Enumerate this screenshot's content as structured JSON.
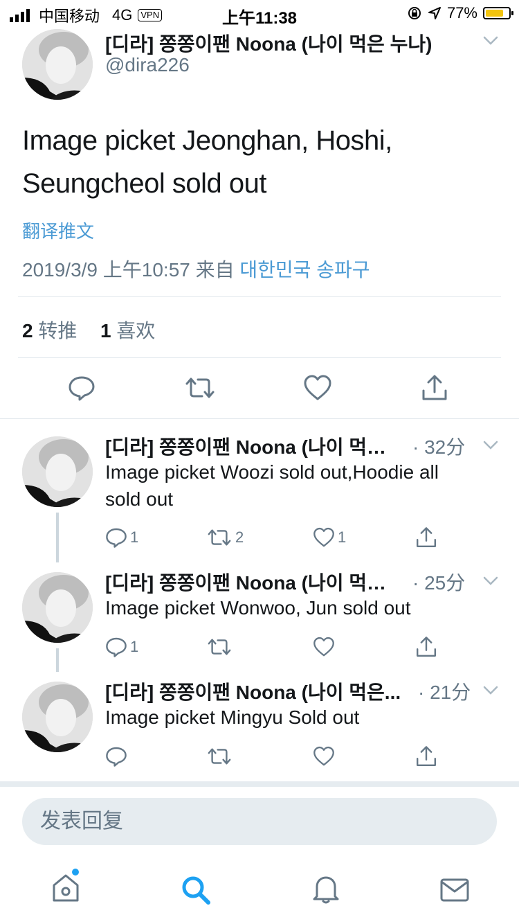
{
  "status_bar": {
    "carrier": "中国移动",
    "network": "4G",
    "vpn": "VPN",
    "time": "上午11:38",
    "battery_pct": "77%",
    "battery_level": 0.77
  },
  "main_tweet": {
    "display_name": "[디라] 쫑쫑이팬 Noona (나이 먹은 누나)",
    "handle": "@dira226",
    "text_line1": "Image picket Jeonghan, Hoshi,",
    "text_line2": "Seungcheol sold out",
    "translate_label": "翻译推文",
    "timestamp": "2019/3/9 上午10:57 来自",
    "location": "대한민국 송파구",
    "retweet_count": "2",
    "retweet_label": "转推",
    "like_count": "1",
    "like_label": "喜欢"
  },
  "replies": [
    {
      "display_name": "[디라] 쫑쫑이팬 Noona (나이 먹…",
      "time": "· 32分",
      "text_line1": "Image picket Woozi sold out,Hoodie all",
      "text_line2": "sold out",
      "reply_count": "1",
      "retweet_count": "2",
      "like_count": "1"
    },
    {
      "display_name": "[디라] 쫑쫑이팬 Noona (나이 먹…",
      "time": "· 25分",
      "text_line1": "Image picket Wonwoo, Jun sold out",
      "reply_count": "1",
      "retweet_count": "",
      "like_count": ""
    },
    {
      "display_name": "[디라] 쫑쫑이팬 Noona (나이 먹은...",
      "time": "· 21分",
      "text_line1": "Image picket Mingyu Sold out",
      "reply_count": "",
      "retweet_count": "",
      "like_count": ""
    }
  ],
  "reply_box": {
    "placeholder": "发表回复"
  },
  "tab_bar": {
    "icons": [
      "home-icon",
      "search-icon",
      "notifications-icon",
      "messages-icon"
    ],
    "accent": "#1da1f2"
  }
}
